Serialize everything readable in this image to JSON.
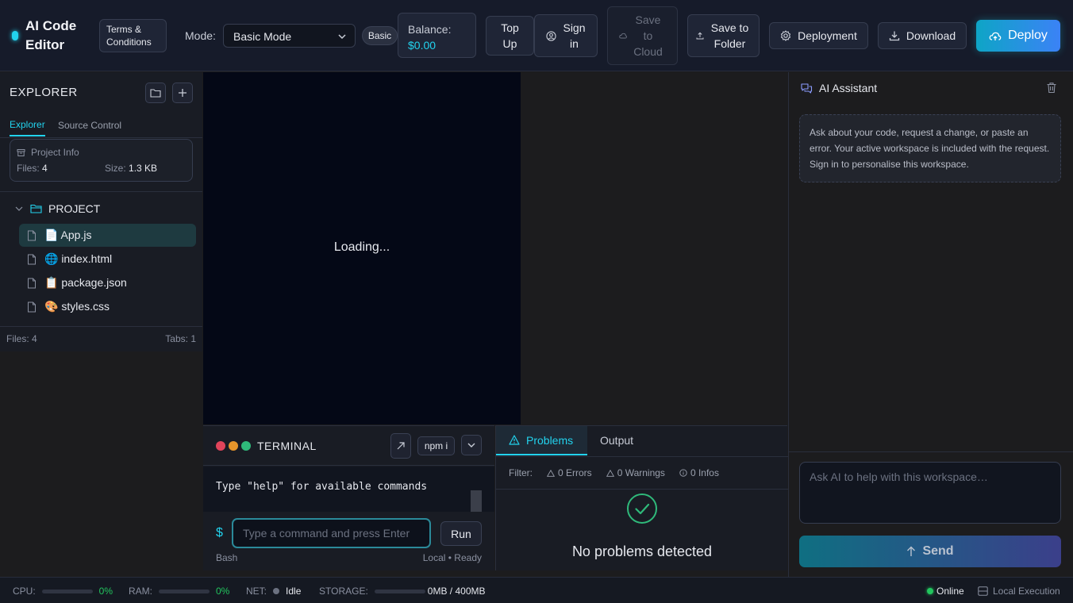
{
  "header": {
    "app_title": "AI Code Editor",
    "terms_label": "Terms & Conditions",
    "mode_label": "Mode:",
    "mode_value": "Basic Mode",
    "mode_badge": "Basic",
    "balance_label": "Balance:",
    "balance_value": "$0.00",
    "top_up_label": "Top Up",
    "sign_in_label": "Sign in",
    "save_cloud_label": "Save to Cloud",
    "save_folder_label": "Save to Folder",
    "deployment_label": "Deployment",
    "download_label": "Download",
    "deploy_label": "Deploy"
  },
  "sidebar": {
    "title": "EXPLORER",
    "tabs": [
      "Explorer",
      "Source Control"
    ],
    "project_info": {
      "title": "Project Info",
      "files_label": "Files:",
      "files_value": "4",
      "size_label": "Size:",
      "size_value": "1.3 KB"
    },
    "project_name": "PROJECT",
    "files": [
      {
        "name": "📄 App.js",
        "active": true
      },
      {
        "name": "🌐 index.html",
        "active": false
      },
      {
        "name": "📋 package.json",
        "active": false
      },
      {
        "name": "🎨 styles.css",
        "active": false
      }
    ],
    "footer_files": "Files: 4",
    "footer_tabs": "Tabs: 1"
  },
  "editor": {
    "loading_text": "Loading..."
  },
  "terminal": {
    "title": "TERMINAL",
    "npm_label": "npm i",
    "output_line": "Type \"help\" for available commands",
    "prompt": "$",
    "input_placeholder": "Type a command and press Enter",
    "run_label": "Run",
    "shell": "Bash",
    "status": "Local • Ready"
  },
  "problems": {
    "tab_problems": "Problems",
    "tab_output": "Output",
    "filter_label": "Filter:",
    "errors": "0 Errors",
    "warnings": "0 Warnings",
    "infos": "0 Infos",
    "empty_text": "No problems detected"
  },
  "ai": {
    "title": "AI Assistant",
    "info_text": "Ask about your code, request a change, or paste an error. Your active workspace is included with the request. Sign in to personalise this workspace.",
    "input_placeholder": "Ask AI to help with this workspace…",
    "send_label": "Send"
  },
  "status": {
    "cpu_label": "CPU:",
    "cpu_value": "0%",
    "ram_label": "RAM:",
    "ram_value": "0%",
    "net_label": "NET:",
    "net_value": "Idle",
    "storage_label": "STORAGE:",
    "storage_value": "0MB / 400MB",
    "online_label": "Online",
    "execution_label": "Local Execution"
  },
  "colors": {
    "accent": "#22d3ee",
    "success": "#22c55e",
    "background": "#1c1c1e",
    "editor_bg": "#040816"
  }
}
